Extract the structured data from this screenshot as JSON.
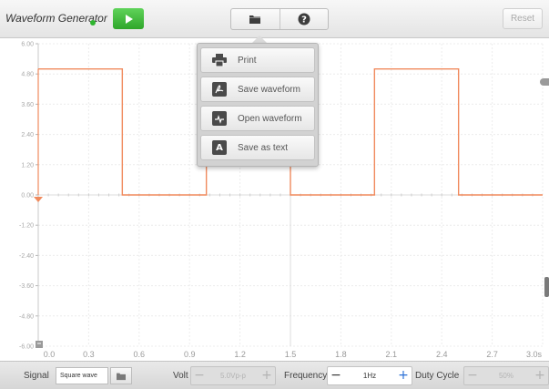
{
  "app": {
    "title": "Waveform Generator",
    "run_color": "#2fb52f"
  },
  "toolbar": {
    "buttons": [
      {
        "icon": "folder-icon"
      },
      {
        "icon": "help-icon"
      }
    ],
    "reset_label": "Reset"
  },
  "menu": {
    "items": [
      {
        "label": "Print",
        "icon": "printer-icon"
      },
      {
        "label": "Save waveform",
        "icon": "pdf-icon"
      },
      {
        "label": "Open waveform",
        "icon": "pdf-icon"
      },
      {
        "label": "Save as text",
        "icon": "text-file-icon"
      }
    ]
  },
  "plot": {
    "y_ticks": [
      "6.00",
      "4.80",
      "3.60",
      "2.40",
      "1.20",
      "0.00",
      "-1.20",
      "-2.40",
      "-3.60",
      "-4.80",
      "-6.00"
    ],
    "x_ticks": [
      "0.0",
      "0.3",
      "0.6",
      "0.9",
      "1.2",
      "1.5",
      "1.8",
      "2.1",
      "2.4",
      "2.7",
      "3.0s"
    ],
    "trace_color": "#f08a5d",
    "waveform": {
      "type": "square",
      "high_v": 5.0,
      "low_v": 0.0,
      "frequency_hz": 1,
      "duty_cycle": 0.5,
      "x_start_s": 0.0,
      "x_end_s": 3.0,
      "y_min_v": -6.0,
      "y_max_v": 6.0
    }
  },
  "bottom": {
    "signal_label": "Signal",
    "signal_value": "Square wave",
    "volt_label": "Volt",
    "volt_value": "5.0Vp-p",
    "frequency_label": "Frequency",
    "frequency_value": "1Hz",
    "duty_label": "Duty Cycle",
    "duty_value": "50%",
    "minus": "−",
    "plus": "+"
  }
}
